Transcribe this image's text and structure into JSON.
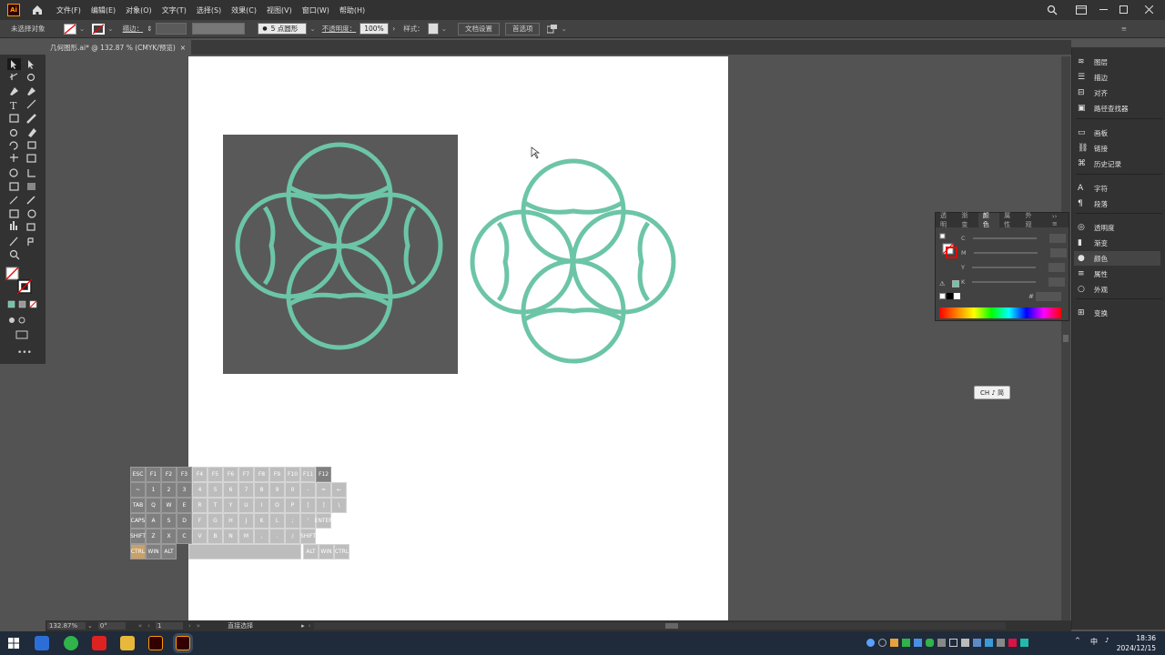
{
  "app": {
    "logo": "Ai",
    "menus": [
      "文件(F)",
      "编辑(E)",
      "对象(O)",
      "文字(T)",
      "选择(S)",
      "效果(C)",
      "视图(V)",
      "窗口(W)",
      "帮助(H)"
    ]
  },
  "control_bar": {
    "selection_label": "未选择对象",
    "stroke_label": "描边：",
    "brush_label": "5 点圆形",
    "opacity_label": "不透明度：",
    "opacity_value": "100%",
    "style_label": "样式：",
    "doc_setup_button": "文档设置",
    "prefs_button": "首选项"
  },
  "document_tab": {
    "title": "几何图形.ai* @ 132.87 % (CMYK/预览)",
    "close": "×"
  },
  "right_panel": {
    "items": [
      "图层",
      "描边",
      "对齐",
      "路径查找器",
      "画板",
      "链接",
      "历史记录",
      "字符",
      "段落",
      "透明度",
      "渐变",
      "颜色",
      "属性",
      "外观",
      "变换"
    ],
    "active": "颜色"
  },
  "color_panel": {
    "tabs": [
      "透明",
      "渐变",
      "颜色",
      "属性",
      "外观"
    ],
    "active_tab": "颜色",
    "channels": [
      "C",
      "M",
      "Y",
      "K"
    ],
    "hex_label": "#"
  },
  "ime_indicator": "CH ♪ 简",
  "status_bar": {
    "zoom": "132.87%",
    "angle": "0°",
    "artboard_num": "1",
    "tool_name": "直接选择"
  },
  "taskbar": {
    "time": "18:36",
    "date": "2024/12/15",
    "lang": "中"
  },
  "artwork": {
    "shape_color": "#6cc5a6",
    "background_square_color": "#595959"
  },
  "keyboard": {
    "row1": [
      "ESC",
      "F1",
      "F2",
      "F3",
      "F4",
      "F5",
      "F6",
      "F7",
      "F8",
      "F9",
      "F10",
      "F11",
      "F12"
    ],
    "row2": [
      "~",
      "1",
      "2",
      "3",
      "4",
      "5",
      "6",
      "7",
      "8",
      "9",
      "0",
      "-",
      "=",
      "←"
    ],
    "row3": [
      "TAB",
      "Q",
      "W",
      "E",
      "R",
      "T",
      "Y",
      "U",
      "I",
      "O",
      "P",
      "[",
      "]",
      "\\"
    ],
    "row4": [
      "CAPS",
      "A",
      "S",
      "D",
      "F",
      "G",
      "H",
      "J",
      "K",
      "L",
      ";",
      "'",
      "ENTER"
    ],
    "row5": [
      "SHIFT",
      "Z",
      "X",
      "C",
      "V",
      "B",
      "N",
      "M",
      ",",
      ".",
      "/",
      "SHIFT"
    ],
    "row6": [
      "CTRL",
      "WIN",
      "ALT",
      "ALT",
      "WIN",
      "CTRL"
    ]
  }
}
